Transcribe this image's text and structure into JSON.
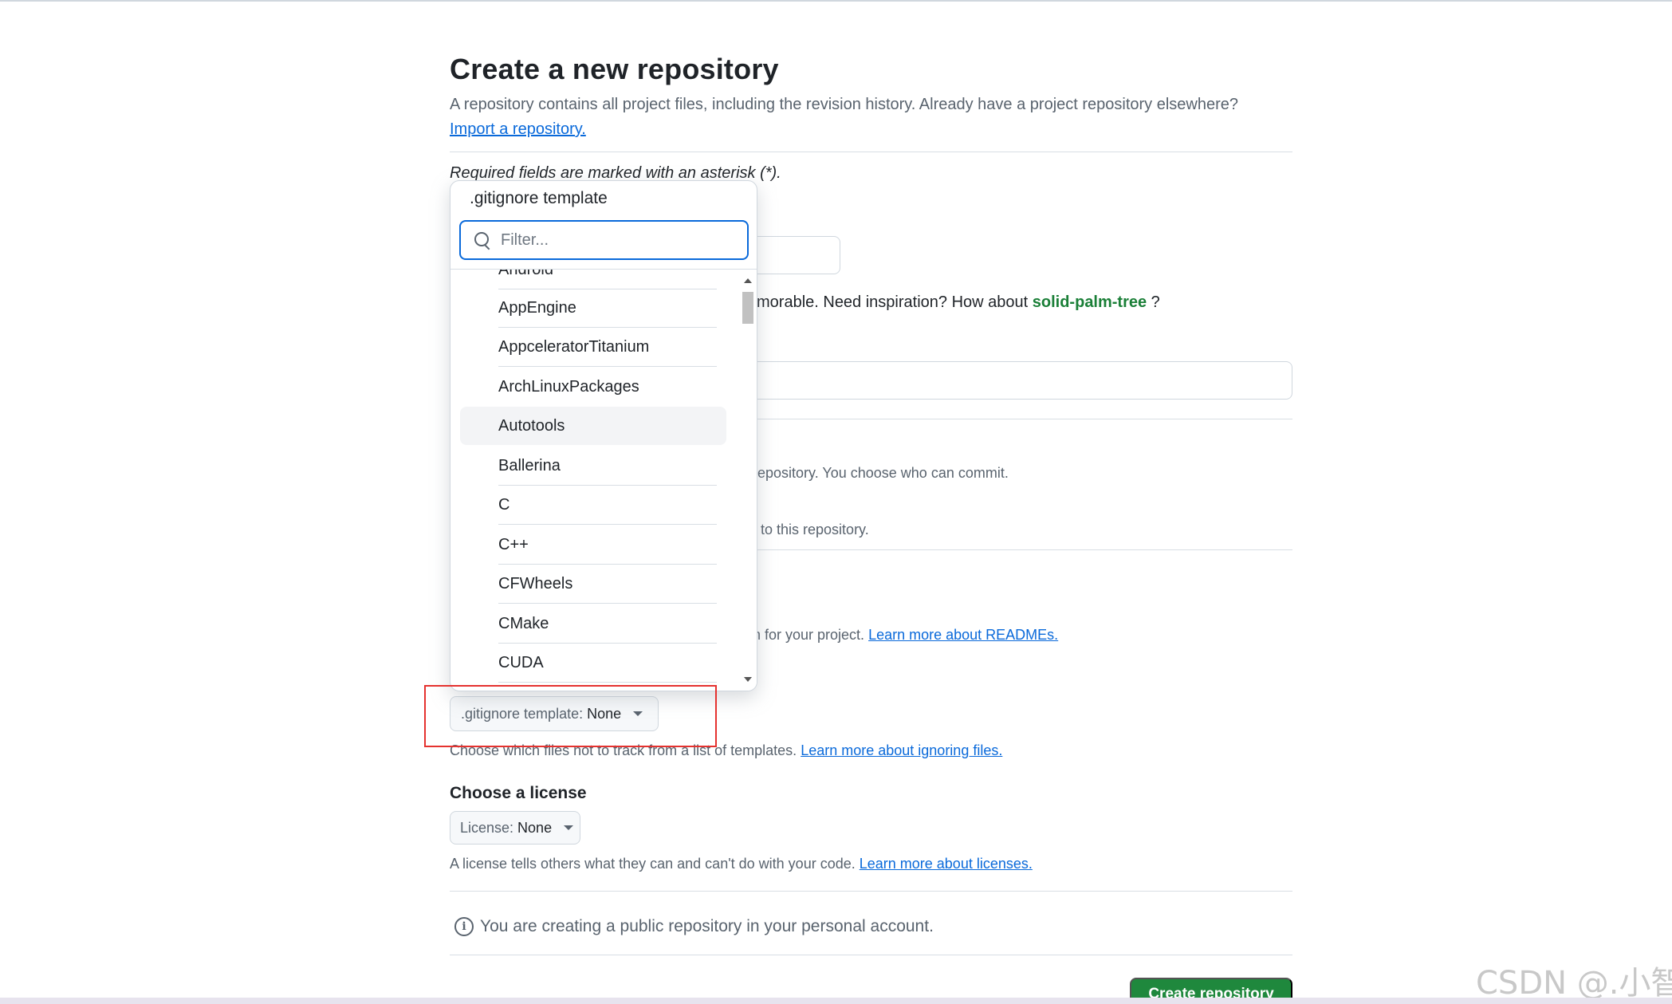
{
  "page": {
    "title": "Create a new repository",
    "subtitle": "A repository contains all project files, including the revision history. Already have a project repository elsewhere?",
    "import_link": "Import a repository.",
    "required_note": "Required fields are marked with an asterisk (*).",
    "name_hint_prefix": "morable. Need inspiration? How about ",
    "name_suggestion": "solid-palm-tree",
    "name_hint_suffix": " ?",
    "visibility_public_desc_fragment": "repository. You choose who can commit.",
    "visibility_private_desc_fragment": "t to this repository.",
    "readme_desc_fragment": "n for your project. ",
    "readme_link": "Learn more about READMEs.",
    "gitignore_button_label": ".gitignore template: ",
    "gitignore_button_value": "None",
    "gitignore_help": "Choose which files not to track from a list of templates. ",
    "gitignore_link": "Learn more about ignoring files.",
    "license_heading": "Choose a license",
    "license_button_label": "License: ",
    "license_button_value": "None",
    "license_help": "A license tells others what they can and can't do with your code. ",
    "license_link": "Learn more about licenses.",
    "public_note": "You are creating a public repository in your personal account.",
    "create_button": "Create repository"
  },
  "dropdown": {
    "title": ".gitignore template",
    "filter_placeholder": "Filter...",
    "items": [
      "Android",
      "AppEngine",
      "AppceleratorTitanium",
      "ArchLinuxPackages",
      "Autotools",
      "Ballerina",
      "C",
      "C++",
      "CFWheels",
      "CMake",
      "CUDA"
    ],
    "hovered_item": "Autotools"
  },
  "watermark": "CSDN @.小智",
  "colors": {
    "link": "#0969da",
    "suggestion_green": "#1a7f37",
    "primary_button": "#1f883d",
    "highlight_red": "#e5322f",
    "focus_blue": "#0969da"
  }
}
